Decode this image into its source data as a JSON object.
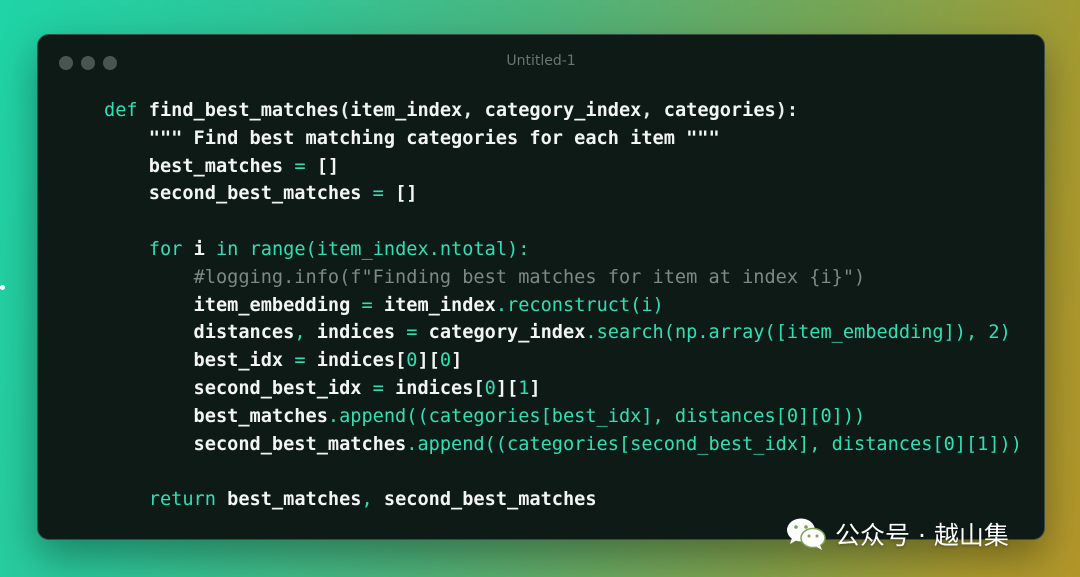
{
  "window": {
    "title": "Untitled-1"
  },
  "code": {
    "lines": [
      [
        {
          "t": "def ",
          "c": "kw"
        },
        {
          "t": "find_best_matches",
          "c": "fn"
        },
        {
          "t": "(",
          "c": "punct"
        },
        {
          "t": "item_index",
          "c": "fn"
        },
        {
          "t": ", ",
          "c": "punct"
        },
        {
          "t": "category_index",
          "c": "fn"
        },
        {
          "t": ", ",
          "c": "punct"
        },
        {
          "t": "categories",
          "c": "fn"
        },
        {
          "t": "):",
          "c": "punct"
        }
      ],
      [
        {
          "t": "    ",
          "c": ""
        },
        {
          "t": "\"\"\" Find best matching categories for each item \"\"\"",
          "c": "doc"
        }
      ],
      [
        {
          "t": "    best_matches ",
          "c": ""
        },
        {
          "t": "=",
          "c": "op"
        },
        {
          "t": " []",
          "c": ""
        }
      ],
      [
        {
          "t": "    second_best_matches ",
          "c": ""
        },
        {
          "t": "=",
          "c": "op"
        },
        {
          "t": " []",
          "c": ""
        }
      ],
      [],
      [
        {
          "t": "    ",
          "c": ""
        },
        {
          "t": "for",
          "c": "kw"
        },
        {
          "t": " i ",
          "c": ""
        },
        {
          "t": "in",
          "c": "kw"
        },
        {
          "t": " ",
          "c": ""
        },
        {
          "t": "range(item_index.ntotal):",
          "c": "meth"
        }
      ],
      [
        {
          "t": "        ",
          "c": ""
        },
        {
          "t": "#logging.info(f\"Finding best matches for item at index {i}\")",
          "c": "cm"
        }
      ],
      [
        {
          "t": "        item_embedding ",
          "c": ""
        },
        {
          "t": "=",
          "c": "op"
        },
        {
          "t": " item_index",
          "c": ""
        },
        {
          "t": ".reconstruct(i)",
          "c": "meth"
        }
      ],
      [
        {
          "t": "        distances",
          "c": ""
        },
        {
          "t": ",",
          "c": "op"
        },
        {
          "t": " indices ",
          "c": ""
        },
        {
          "t": "=",
          "c": "op"
        },
        {
          "t": " category_index",
          "c": ""
        },
        {
          "t": ".search(np.array([item_embedding]), 2)",
          "c": "meth"
        }
      ],
      [
        {
          "t": "        best_idx ",
          "c": ""
        },
        {
          "t": "=",
          "c": "op"
        },
        {
          "t": " indices[",
          "c": ""
        },
        {
          "t": "0",
          "c": "num"
        },
        {
          "t": "][",
          "c": ""
        },
        {
          "t": "0",
          "c": "num"
        },
        {
          "t": "]",
          "c": ""
        }
      ],
      [
        {
          "t": "        second_best_idx ",
          "c": ""
        },
        {
          "t": "=",
          "c": "op"
        },
        {
          "t": " indices[",
          "c": ""
        },
        {
          "t": "0",
          "c": "num"
        },
        {
          "t": "][",
          "c": ""
        },
        {
          "t": "1",
          "c": "num"
        },
        {
          "t": "]",
          "c": ""
        }
      ],
      [
        {
          "t": "        best_matches",
          "c": ""
        },
        {
          "t": ".append((categories[best_idx], distances[0][0]))",
          "c": "meth"
        }
      ],
      [
        {
          "t": "        second_best_matches",
          "c": ""
        },
        {
          "t": ".append((categories[second_best_idx], distances[0][1]))",
          "c": "meth"
        }
      ],
      [],
      [
        {
          "t": "    ",
          "c": ""
        },
        {
          "t": "return",
          "c": "kw"
        },
        {
          "t": " best_matches",
          "c": ""
        },
        {
          "t": ",",
          "c": "op"
        },
        {
          "t": " second_best_matches",
          "c": ""
        }
      ]
    ]
  },
  "watermark": {
    "text": "公众号 · 越山集",
    "icon": "wechat-icon"
  },
  "colors": {
    "keyword": "#2fe0b6",
    "text": "#f2f5f3",
    "comment": "#7c8a84",
    "window_bg": "#0e1a16"
  }
}
